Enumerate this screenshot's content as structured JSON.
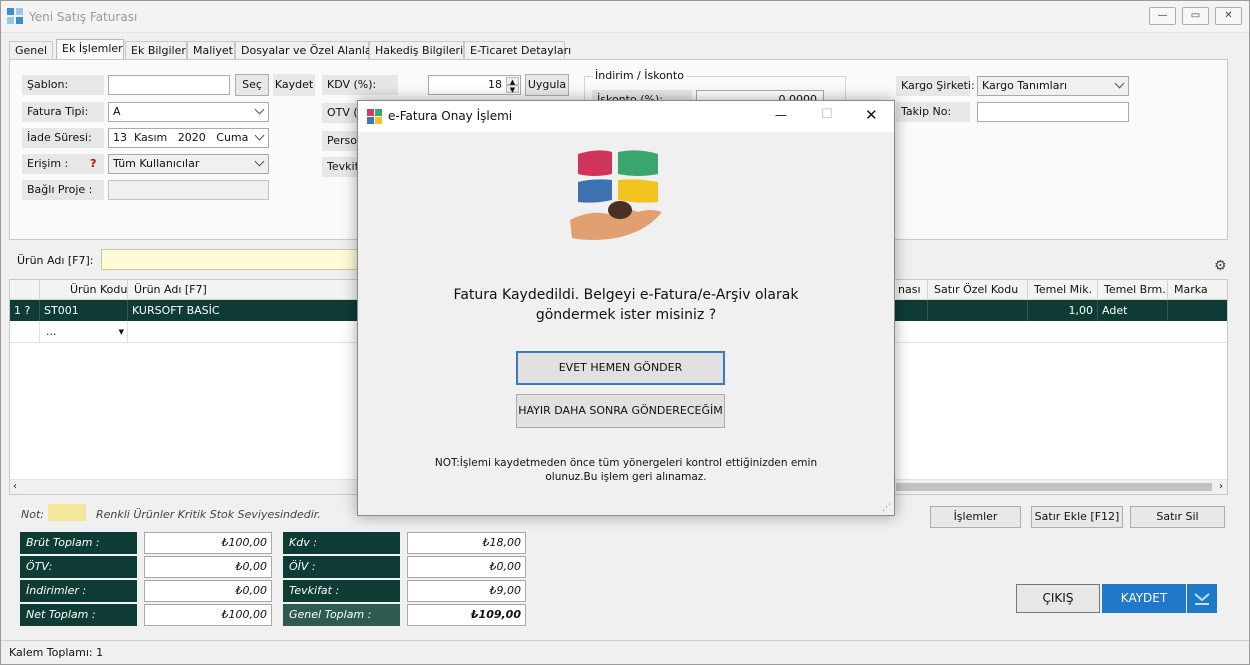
{
  "window": {
    "title": "Yeni Satış Faturası",
    "controls": [
      "minimize",
      "restore",
      "close"
    ]
  },
  "tabs": [
    "Genel",
    "Ek İşlemler",
    "Ek Bilgiler",
    "Maliyet",
    "Dosyalar ve Özel Alanlar",
    "Hakediş Bilgileri",
    "E-Ticaret Detayları"
  ],
  "active_tab": "Ek İşlemler",
  "form": {
    "sablon_label": "Şablon:",
    "sablon_value": "",
    "sec_button": "Seç",
    "kaydet_button": "Kaydet",
    "fatura_tipi_label": "Fatura Tipi:",
    "fatura_tipi_value": "A",
    "iade_suresi_label": "İade Süresi:",
    "iade_day": "13",
    "iade_month": "Kasım",
    "iade_year": "2020",
    "iade_weekday": "Cuma",
    "erisim_label": "Erişim :",
    "erisim_help": "?",
    "erisim_value": "Tüm Kullanıcılar",
    "bagli_proje_label": "Bağlı Proje :",
    "bagli_proje_value": "",
    "kdv_label": "KDV (%):",
    "kdv_value": "18",
    "uygula_button": "Uygula",
    "otv_label": "OTV (",
    "personel_label": "Perso",
    "tevkifat_label": "Tevkif",
    "indirim_group": "İndirim / İskonto",
    "iskonto_label": "İskonto (%):",
    "iskonto_value": "0,0000",
    "kargo_label": "Kargo Şirketi:",
    "kargo_value": "Kargo Tanımları",
    "takip_label": "Takip No:",
    "takip_value": ""
  },
  "product_search": {
    "label": "Ürün Adı [F7]:",
    "value": ""
  },
  "grid": {
    "headers_left": [
      "",
      "Ürün Kodu",
      "Ürün Adı [F7]"
    ],
    "headers_right": [
      "nası",
      "Satır Özel Kodu",
      "Temel Mik.",
      "Temel Brm.",
      "Marka"
    ],
    "row": {
      "index": "1 ?",
      "code": "ST001",
      "name": "KURSOFT BASİC",
      "qty": "1,00",
      "unit": "Adet"
    },
    "empty_row_code": "..."
  },
  "actions": {
    "islemler": "İşlemler",
    "satir_ekle": "Satır Ekle [F12]",
    "satir_sil": "Satır Sil"
  },
  "note": {
    "label": "Not:",
    "text": "Renkli Ürünler Kritik Stok Seviyesindedir.",
    "swatch_color": "#f3e79b"
  },
  "totals": {
    "brut_label": "Brüt Toplam :",
    "brut_value": "₺100,00",
    "otv_label": "ÖTV:",
    "otv_value": "₺0,00",
    "indirim_label": "İndirimler :",
    "indirim_value": "₺0,00",
    "net_label": "Net Toplam :",
    "net_value": "₺100,00",
    "kdv_label": "Kdv :",
    "kdv_value": "₺18,00",
    "oiv_label": "ÖİV :",
    "oiv_value": "₺0,00",
    "tevkifat_label": "Tevkifat :",
    "tevkifat_value": "₺9,00",
    "genel_label": "Genel Toplam :",
    "genel_value": "₺109,00"
  },
  "footer_buttons": {
    "cikis": "ÇIKIŞ",
    "kaydet": "KAYDET"
  },
  "status": {
    "kalem_toplami": "Kalem Toplamı: 1"
  },
  "dialog": {
    "title": "e-Fatura Onay İşlemi",
    "message_line1": "Fatura Kaydedildi. Belgeyi e-Fatura/e-Arşiv olarak",
    "message_line2": "göndermek ister misiniz ?",
    "yes_button": "EVET HEMEN GÖNDER",
    "no_button": "HAYIR DAHA SONRA GÖNDERECEĞİM",
    "note_line1": "NOT:İşlemi kaydetmeden önce tüm yönergeleri kontrol ettiğinizden emin",
    "note_line2": "olunuz.Bu işlem geri alınamaz."
  },
  "colors": {
    "dark_teal": "#0e3c35",
    "accent_blue": "#1f78c8",
    "disabled_text": "#9a9a9a"
  }
}
